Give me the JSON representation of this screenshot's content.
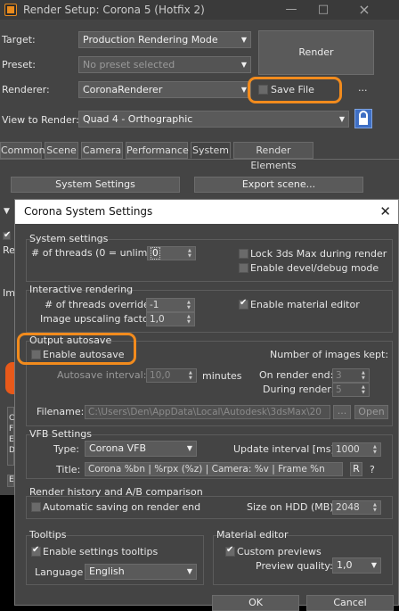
{
  "render_setup": {
    "title": "Render Setup: Corona 5 (Hotfix 2)",
    "target_label": "Target:",
    "target_value": "Production Rendering Mode",
    "preset_label": "Preset:",
    "preset_placeholder": "No preset selected",
    "renderer_label": "Renderer:",
    "renderer_value": "CoronaRenderer",
    "save_file_label": "Save File",
    "ellipsis": "...",
    "view_label": "View to Render:",
    "view_value": "Quad 4 - Orthographic",
    "render_button": "Render",
    "tabs": [
      "Common",
      "Scene",
      "Camera",
      "Performance",
      "System",
      "Render Elements"
    ],
    "active_tab": "System",
    "system_settings_button": "System Settings",
    "export_scene_button": "Export scene...",
    "side_fragments": [
      "Re",
      "Im",
      "C",
      "F",
      "E",
      "D",
      "E"
    ]
  },
  "dialog": {
    "title": "Corona System Settings",
    "system": {
      "header": "System settings",
      "threads_label": "# of threads (0 = unlim.):",
      "threads_value": "0",
      "lock_label": "Lock 3ds Max during render",
      "devel_label": "Enable devel/debug mode"
    },
    "interactive": {
      "header": "Interactive rendering",
      "threads_override_label": "# of threads override:",
      "threads_override_value": "-1",
      "upscaling_label": "Image upscaling factor:",
      "upscaling_value": "1,0",
      "material_editor_label": "Enable material editor",
      "material_editor_checked": true
    },
    "autosave": {
      "header": "Output autosave",
      "enable_label": "Enable autosave",
      "enabled": false,
      "interval_label": "Autosave interval:",
      "interval_value": "10,0",
      "interval_unit": "minutes",
      "images_kept_label": "Number of images kept:",
      "on_render_end_label": "On render end:",
      "on_render_end_value": "3",
      "during_render_label": "During render:",
      "during_render_value": "5",
      "filename_label": "Filename:",
      "filename_value": "C:\\Users\\Den\\AppData\\Local\\Autodesk\\3dsMax\\20",
      "browse_button": "...",
      "open_button": "Open"
    },
    "vfb": {
      "header": "VFB Settings",
      "type_label": "Type:",
      "type_value": "Corona VFB",
      "update_label": "Update interval [ms]:",
      "update_value": "1000",
      "title_label": "Title:",
      "title_value": "Corona %bn | %rpx (%z) | Camera: %v | Frame %n",
      "r_button": "R",
      "help_button": "?"
    },
    "history": {
      "header": "Render history and A/B comparison",
      "auto_save_label": "Automatic saving on render end",
      "auto_save_checked": false,
      "size_label": "Size on HDD (MB):",
      "size_value": "2048"
    },
    "tooltips": {
      "header": "Tooltips",
      "enable_label": "Enable settings tooltips",
      "enable_checked": true,
      "language_label": "Language",
      "language_value": "English"
    },
    "material_editor": {
      "header": "Material editor",
      "custom_previews_label": "Custom previews",
      "custom_previews_checked": true,
      "preview_quality_label": "Preview quality:",
      "preview_quality_value": "1,0"
    },
    "ok_button": "OK",
    "cancel_button": "Cancel"
  },
  "colors": {
    "highlight": "#f28b1d",
    "panel": "#444444",
    "dialog_title_bg": "#ffffff"
  }
}
